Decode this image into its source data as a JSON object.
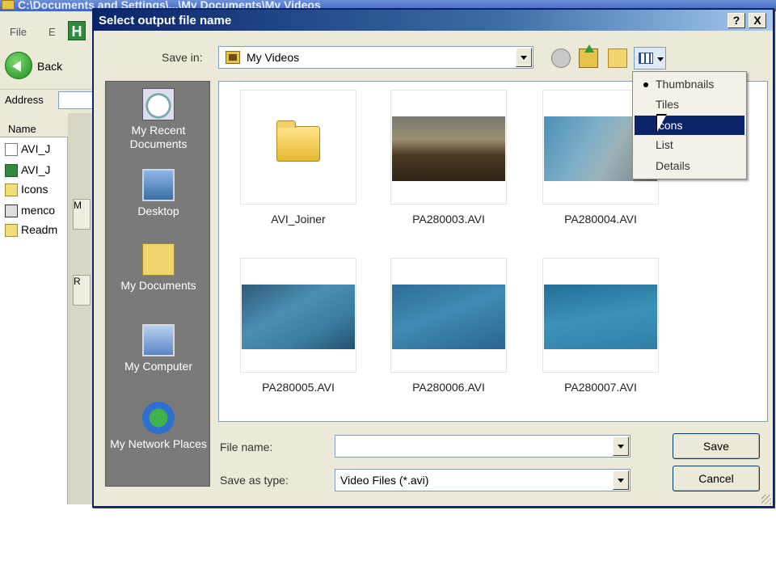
{
  "background_window": {
    "title": "C:\\Documents and Settings\\...\\My Documents\\My Videos",
    "menu": [
      "File",
      "E"
    ],
    "back_label": "Back",
    "address_label": "Address",
    "list_header": "Name",
    "files": [
      {
        "name": "AVI_J",
        "icon": "generic-file-icon"
      },
      {
        "name": "AVI_J",
        "icon": "green-app-icon"
      },
      {
        "name": "Icons",
        "icon": "text-file-icon"
      },
      {
        "name": "menco",
        "icon": "window-app-icon"
      },
      {
        "name": "Readm",
        "icon": "notepad-file-icon"
      }
    ],
    "task_labels": [
      "M",
      "R"
    ]
  },
  "dialog": {
    "title": "Select output file name",
    "help_button": "?",
    "close_button": "X",
    "save_in_label": "Save in:",
    "save_in_value": "My Videos",
    "places": [
      {
        "label": "My Recent Documents",
        "icon": "recent-documents-icon"
      },
      {
        "label": "Desktop",
        "icon": "desktop-icon"
      },
      {
        "label": "My Documents",
        "icon": "my-documents-icon"
      },
      {
        "label": "My Computer",
        "icon": "my-computer-icon"
      },
      {
        "label": "My Network Places",
        "icon": "network-places-icon"
      }
    ],
    "items": [
      {
        "name": "AVI_Joiner",
        "kind": "folder"
      },
      {
        "name": "PA280003.AVI",
        "kind": "video"
      },
      {
        "name": "PA280004.AVI",
        "kind": "video"
      },
      {
        "name": "PA280005.AVI",
        "kind": "video"
      },
      {
        "name": "PA280006.AVI",
        "kind": "video"
      },
      {
        "name": "PA280007.AVI",
        "kind": "video"
      }
    ],
    "file_name_label": "File name:",
    "file_name_value": "",
    "save_as_type_label": "Save as type:",
    "save_as_type_value": "Video Files (*.avi)",
    "save_button": "Save",
    "cancel_button": "Cancel",
    "views_menu": [
      {
        "label": "Thumbnails",
        "checked": true
      },
      {
        "label": "Tiles",
        "checked": false
      },
      {
        "label": "Icons",
        "checked": false,
        "highlighted": true
      },
      {
        "label": "List",
        "checked": false
      },
      {
        "label": "Details",
        "checked": false
      }
    ]
  },
  "colors": {
    "dialog_title_start": "#0a246a",
    "dialog_title_end": "#a6caf0",
    "places_bar": "#7a7a78",
    "face": "#ece9d8",
    "menu_highlight": "#0a246a"
  }
}
